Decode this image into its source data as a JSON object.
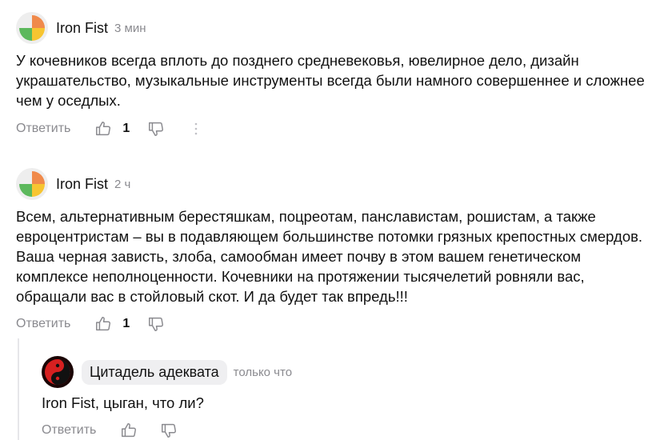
{
  "comments": [
    {
      "author": "Iron Fist",
      "time": "3 мин",
      "text": "У кочевников всегда вплоть до позднего средневековья, ювелирное дело, дизайн украшательство, музыкальные инструменты всегда были намного совершеннее и сложнее чем у оседлых.",
      "reply_label": "Ответить",
      "likes": "1"
    },
    {
      "author": "Iron Fist",
      "time": "2 ч",
      "text": "Всем, альтернативным берестяшкам, поцреотам, панславистам, рошистам, а также евроцентристам – вы в подавляющем большинстве потомки грязных крепостных смердов. Ваша черная зависть, злоба, самообман имеет почву в этом вашем генетическом комплексе неполноценности. Кочевники на протяжении тысячелетий ровняли вас, обращали вас в стойловый скот. И да будет так впредь!!!",
      "reply_label": "Ответить",
      "likes": "1"
    }
  ],
  "reply": {
    "author": "Цитадель адеквата",
    "time": "только что",
    "text": "Iron Fist, цыган, что ли?",
    "reply_label": "Ответить"
  },
  "colors": {
    "muted": "#8a8a8f",
    "chip": "#efeff1",
    "avatar_orange": "#f08a4b",
    "avatar_yellow": "#f7c531",
    "avatar_green": "#5cb85c",
    "avatar_red": "#d62020"
  },
  "icons": [
    "thumb-up-icon",
    "thumb-down-icon",
    "more-icon"
  ]
}
